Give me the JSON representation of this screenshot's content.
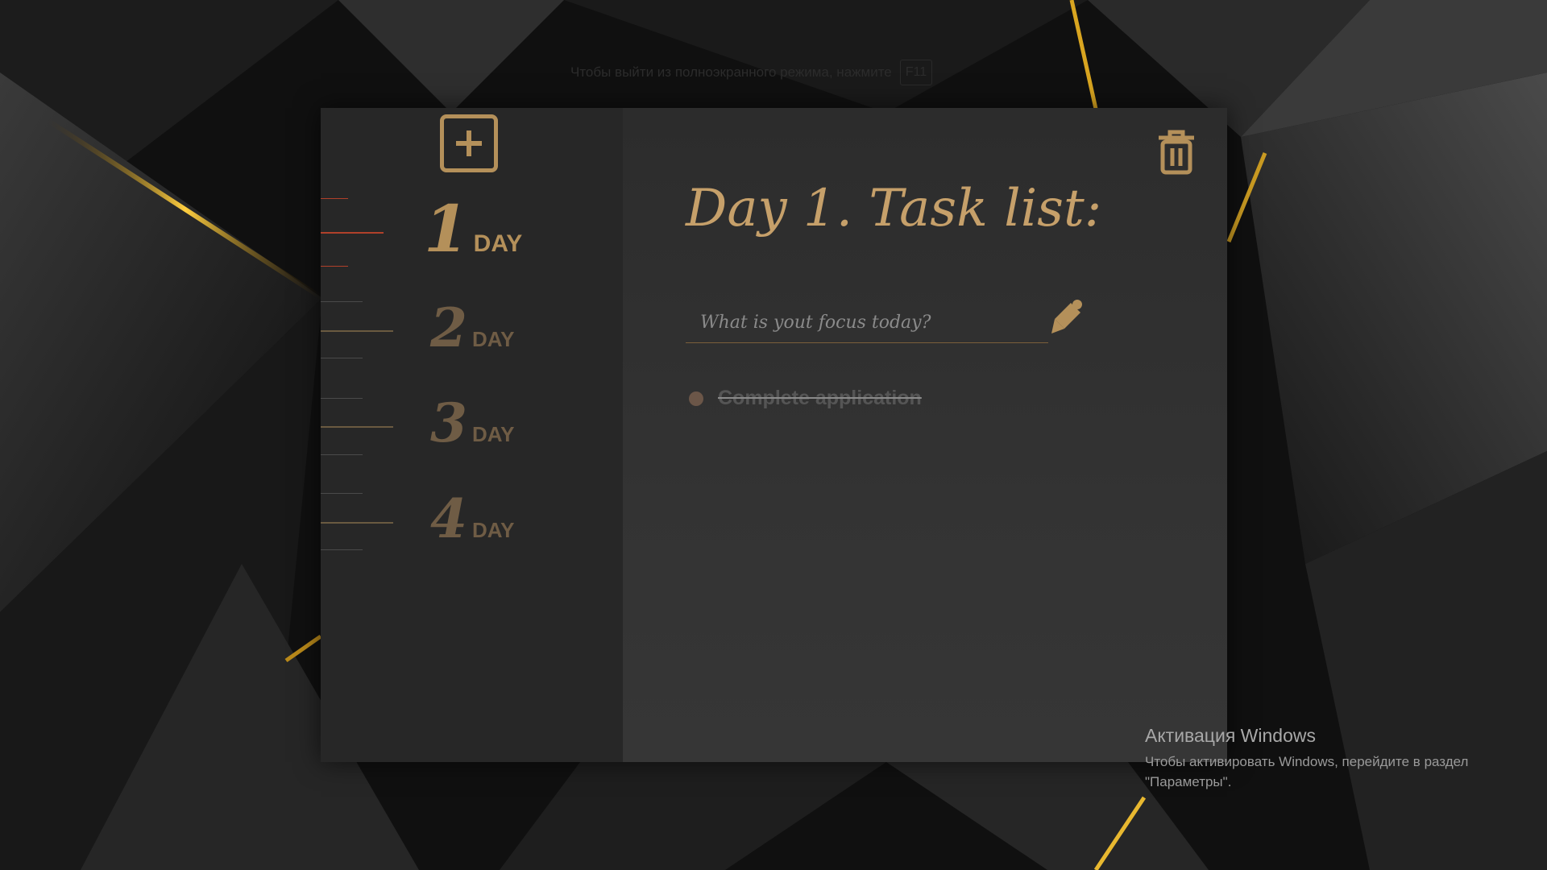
{
  "browser": {
    "fullscreen_hint": "Чтобы выйти из полноэкранного режима, нажмите",
    "fullscreen_key": "F11"
  },
  "sidebar": {
    "add_button_icon": "plus-square-icon",
    "days": [
      {
        "number": "1",
        "label": "DAY",
        "active": true
      },
      {
        "number": "2",
        "label": "DAY",
        "active": false
      },
      {
        "number": "3",
        "label": "DAY",
        "active": false
      },
      {
        "number": "4",
        "label": "DAY",
        "active": false
      }
    ]
  },
  "main": {
    "title": "Day 1. Task list:",
    "trash_icon": "trash-icon",
    "input": {
      "placeholder": "What is yout focus today?",
      "value": ""
    },
    "submit_icon": "pen-icon",
    "tasks": [
      {
        "text": "Complete application",
        "completed": true
      }
    ]
  },
  "windows_activation": {
    "title": "Активация Windows",
    "line1": "Чтобы активировать Windows, перейдите в раздел",
    "line2": "\"Параметры\"."
  },
  "colors": {
    "accent": "#b4905a",
    "sidebar_bg": "#272727",
    "main_bg": "#303030",
    "active_marker": "#b0402a"
  }
}
